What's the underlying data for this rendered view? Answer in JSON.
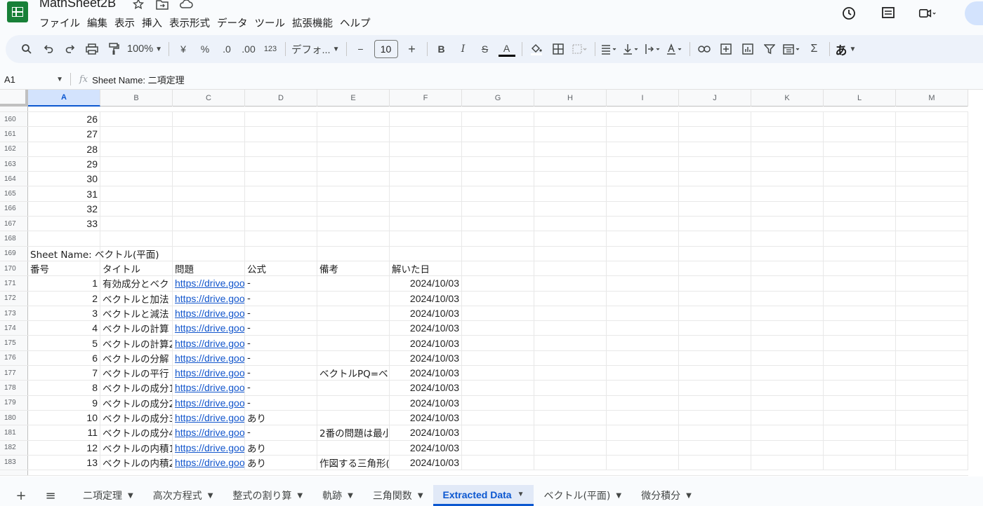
{
  "app": {
    "title": "MathSheet2B",
    "menus": [
      "ファイル",
      "編集",
      "表示",
      "挿入",
      "表示形式",
      "データ",
      "ツール",
      "拡張機能",
      "ヘルプ"
    ]
  },
  "toolbar": {
    "zoom": "100%",
    "currency": "¥",
    "percent": "%",
    "decrease_decimal": ".0",
    "increase_decimal": ".00",
    "number_format": "123",
    "font": "デフォ...",
    "font_size": "10",
    "minus": "−",
    "plus": "+",
    "bold": "B",
    "italic": "I",
    "strike": "S",
    "text_color": "A",
    "sigma": "Σ",
    "input_mode": "あ"
  },
  "formula": {
    "cell_ref": "A1",
    "fx": "fx",
    "content": "Sheet Name: 二項定理"
  },
  "columns": [
    "A",
    "B",
    "C",
    "D",
    "E",
    "F",
    "G",
    "H",
    "I",
    "J",
    "K",
    "L",
    "M"
  ],
  "rows": [
    {
      "n": "160",
      "cells": [
        "26",
        "",
        "",
        "",
        "",
        ""
      ]
    },
    {
      "n": "161",
      "cells": [
        "27",
        "",
        "",
        "",
        "",
        ""
      ]
    },
    {
      "n": "162",
      "cells": [
        "28",
        "",
        "",
        "",
        "",
        ""
      ]
    },
    {
      "n": "163",
      "cells": [
        "29",
        "",
        "",
        "",
        "",
        ""
      ]
    },
    {
      "n": "164",
      "cells": [
        "30",
        "",
        "",
        "",
        "",
        ""
      ]
    },
    {
      "n": "165",
      "cells": [
        "31",
        "",
        "",
        "",
        "",
        ""
      ]
    },
    {
      "n": "166",
      "cells": [
        "32",
        "",
        "",
        "",
        "",
        ""
      ]
    },
    {
      "n": "167",
      "cells": [
        "33",
        "",
        "",
        "",
        "",
        ""
      ]
    },
    {
      "n": "168",
      "cells": [
        "",
        "",
        "",
        "",
        "",
        ""
      ]
    },
    {
      "n": "169",
      "cells": [
        "Sheet Name: ベクトル(平面)",
        "",
        "",
        "",
        "",
        ""
      ]
    },
    {
      "n": "170",
      "cells": [
        "番号",
        "タイトル",
        "問題",
        "公式",
        "備考",
        "解いた日"
      ]
    },
    {
      "n": "171",
      "cells": [
        "1",
        "有効成分とベク",
        "https://drive.goo",
        "-",
        "",
        "2024/10/03"
      ]
    },
    {
      "n": "172",
      "cells": [
        "2",
        "ベクトルと加法",
        "https://drive.goo",
        "-",
        "",
        "2024/10/03"
      ]
    },
    {
      "n": "173",
      "cells": [
        "3",
        "ベクトルと減法",
        "https://drive.goo",
        "-",
        "",
        "2024/10/03"
      ]
    },
    {
      "n": "174",
      "cells": [
        "4",
        "ベクトルの計算",
        "https://drive.goo",
        "-",
        "",
        "2024/10/03"
      ]
    },
    {
      "n": "175",
      "cells": [
        "5",
        "ベクトルの計算2",
        "https://drive.goo",
        "-",
        "",
        "2024/10/03"
      ]
    },
    {
      "n": "176",
      "cells": [
        "6",
        "ベクトルの分解",
        "https://drive.goo",
        "-",
        "",
        "2024/10/03"
      ]
    },
    {
      "n": "177",
      "cells": [
        "7",
        "ベクトルの平行",
        "https://drive.goo",
        "-",
        "ベクトルPQ=ベ",
        "2024/10/03"
      ]
    },
    {
      "n": "178",
      "cells": [
        "8",
        "ベクトルの成分1",
        "https://drive.goo",
        "-",
        "",
        "2024/10/03"
      ]
    },
    {
      "n": "179",
      "cells": [
        "9",
        "ベクトルの成分2",
        "https://drive.goo",
        "-",
        "",
        "2024/10/03"
      ]
    },
    {
      "n": "180",
      "cells": [
        "10",
        "ベクトルの成分3",
        "https://drive.goo",
        "あり",
        "",
        "2024/10/03"
      ]
    },
    {
      "n": "181",
      "cells": [
        "11",
        "ベクトルの成分4",
        "https://drive.goo",
        "-",
        "2番の問題は最小",
        "2024/10/03"
      ]
    },
    {
      "n": "182",
      "cells": [
        "12",
        "ベクトルの内積1",
        "https://drive.goo",
        "あり",
        "",
        "2024/10/03"
      ]
    },
    {
      "n": "183",
      "cells": [
        "13",
        "ベクトルの内積2",
        "https://drive.goo",
        "あり",
        "作図する三角形(",
        "2024/10/03"
      ]
    }
  ],
  "sheets": [
    {
      "label": "二項定理",
      "active": false
    },
    {
      "label": "高次方程式",
      "active": false
    },
    {
      "label": "整式の割り算",
      "active": false
    },
    {
      "label": "軌跡",
      "active": false
    },
    {
      "label": "三角関数",
      "active": false
    },
    {
      "label": "Extracted Data",
      "active": true
    },
    {
      "label": "ベクトル(平面)",
      "active": false
    },
    {
      "label": "微分積分",
      "active": false
    }
  ],
  "colors": {
    "brand": "#188038",
    "link": "#1155cc",
    "active_tab": "#0b57d0"
  }
}
